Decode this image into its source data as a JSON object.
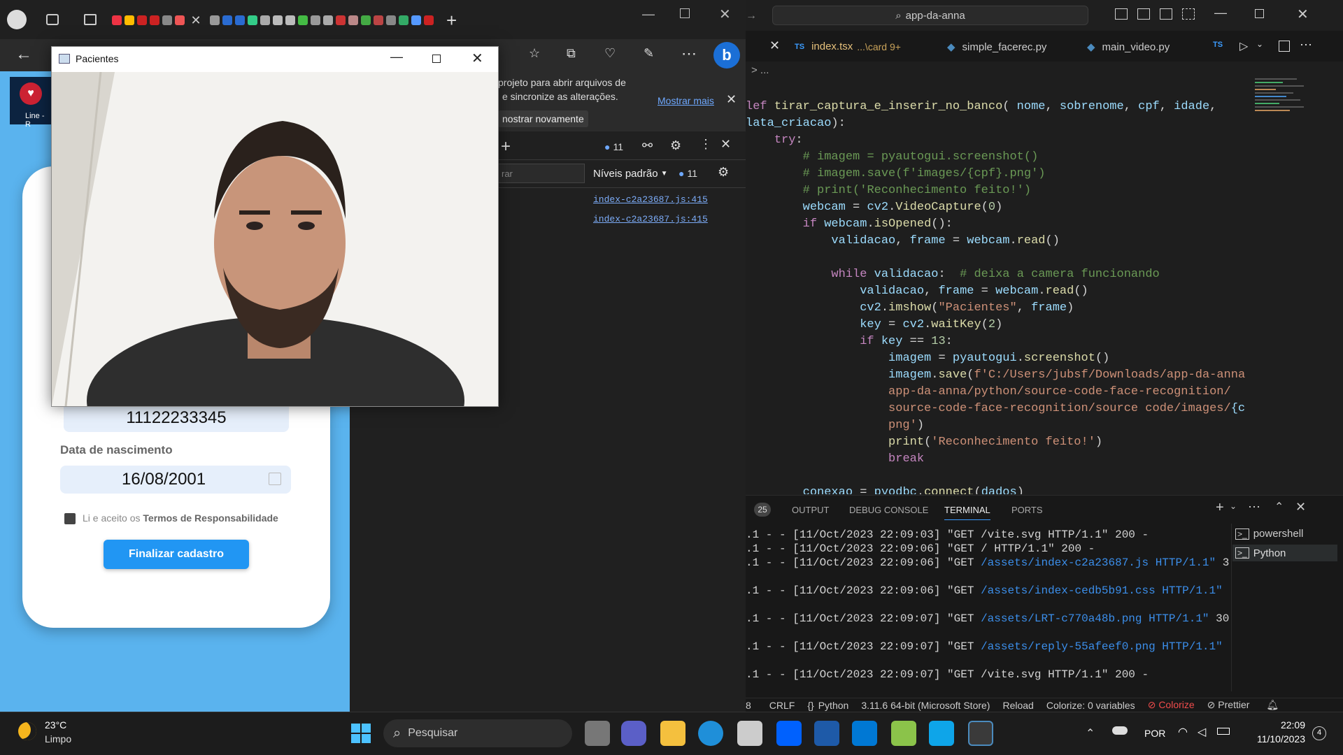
{
  "edge": {
    "address_text": "",
    "notification": {
      "line1": "projeto para abrir arquivos de",
      "line2": "e sincronize as alterações.",
      "show_more": "Mostrar mais",
      "dont_show": "nostrar novamente"
    },
    "devtools": {
      "issues_count": "11",
      "levels_label": "Níveis padrão",
      "levels_count": "11",
      "filter_placeholder": "rar",
      "link1": "index-c2a23687.js:415",
      "link2": "index-c2a23687.js:415"
    },
    "app": {
      "logo_text": "Line - R",
      "cpf_value": "11122233345",
      "birth_label": "Data de nascimento",
      "birth_value": "16/08/2001",
      "terms_prefix": "Li e aceito os ",
      "terms_link": "Termos de Responsabilidade",
      "submit": "Finalizar cadastro"
    }
  },
  "pacientes": {
    "title": "Pacientes"
  },
  "vscode": {
    "search": "app-da-anna",
    "tabs": [
      {
        "badge": "TS",
        "name": "index.tsx",
        "detail": "...\\card 9+"
      },
      {
        "badge": "py",
        "name": "simple_facerec.py",
        "detail": ""
      },
      {
        "badge": "py",
        "name": "main_video.py",
        "detail": ""
      },
      {
        "badge": "TS",
        "name": "",
        "detail": ""
      }
    ],
    "breadcrumb": "> ...",
    "panel_tabs": [
      "25",
      "OUTPUT",
      "DEBUG CONSOLE",
      "TERMINAL",
      "PORTS"
    ],
    "terminal_lines": [
      ".1 - - [11/Oct/2023 22:09:03] \"GET /vite.svg HTTP/1.1\" 200 -",
      ".1 - - [11/Oct/2023 22:09:06] \"GET / HTTP/1.1\" 200 -",
      ".1 - - [11/Oct/2023 22:09:06] \"GET /assets/index-c2a23687.js HTTP/1.1\" 3",
      "",
      ".1 - - [11/Oct/2023 22:09:06] \"GET /assets/index-cedb5b91.css HTTP/1.1\"",
      "",
      ".1 - - [11/Oct/2023 22:09:07] \"GET /assets/LRT-c770a48b.png HTTP/1.1\" 30",
      "",
      ".1 - - [11/Oct/2023 22:09:07] \"GET /assets/reply-55afeef0.png HTTP/1.1\"",
      "",
      ".1 - - [11/Oct/2023 22:09:07] \"GET /vite.svg HTTP/1.1\" 200 -"
    ],
    "terminals": [
      "powershell",
      "Python"
    ],
    "status": {
      "eol": "CRLF",
      "lang": "Python",
      "interp": "3.11.6 64-bit (Microsoft Store)",
      "reload": "Reload",
      "colorize_vars": "Colorize: 0 variables",
      "colorize": "Colorize",
      "prettier": "Prettier",
      "left": "8"
    }
  },
  "taskbar": {
    "temp": "23°C",
    "weather": "Limpo",
    "search": "Pesquisar",
    "lang": "POR",
    "time": "22:09",
    "date": "11/10/2023",
    "notif": "4"
  }
}
